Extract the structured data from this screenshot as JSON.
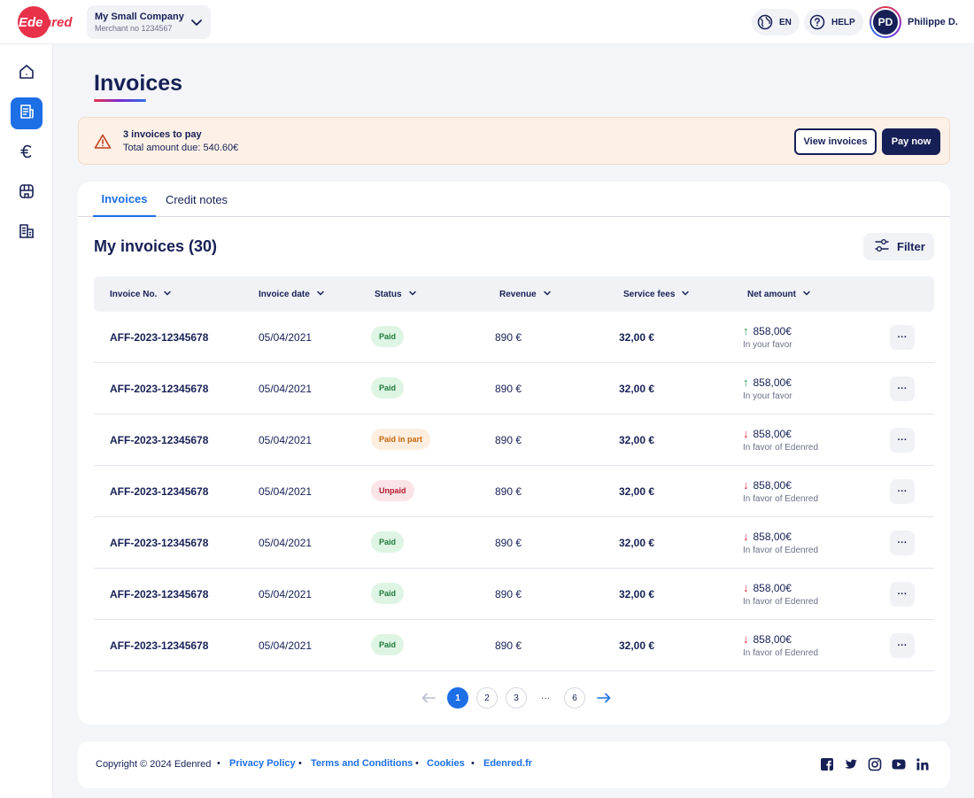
{
  "brand": {
    "logo_text": "Edenred",
    "accent": "#e9314a",
    "primary": "#162056",
    "blue": "#1d6fe6"
  },
  "merchant": {
    "name": "My Small Company",
    "number": "Merchant no 1234567"
  },
  "header": {
    "language": "EN",
    "help": "HELP",
    "user_initials": "PD",
    "user_name": "Philippe D."
  },
  "sidebar": {
    "items": [
      {
        "icon": "home-icon",
        "active": false
      },
      {
        "icon": "invoice-icon",
        "active": true
      },
      {
        "icon": "euro-icon",
        "active": false
      },
      {
        "icon": "store-icon",
        "active": false
      },
      {
        "icon": "building-icon",
        "active": false
      }
    ]
  },
  "page": {
    "title": "Invoices"
  },
  "alert": {
    "title": "3 invoices to pay",
    "subtitle": "Total amount due: 540.60€",
    "view_label": "View invoices",
    "pay_label": "Pay now"
  },
  "tabs": [
    {
      "label": "Invoices",
      "active": true
    },
    {
      "label": "Credit notes",
      "active": false
    }
  ],
  "section": {
    "title": "My invoices (30)",
    "filter_label": "Filter"
  },
  "table": {
    "columns": [
      "Invoice No.",
      "Invoice date",
      "Status",
      "Revenue",
      "Service fees",
      "Net amount"
    ],
    "rows": [
      {
        "invoice_no": "AFF-2023-12345678",
        "date": "05/04/2021",
        "status": "Paid",
        "status_type": "paid",
        "revenue": "890 €",
        "fees": "32,00 €",
        "net": "858,00€",
        "direction": "up",
        "net_note": "In your favor",
        "more": "···"
      },
      {
        "invoice_no": "AFF-2023-12345678",
        "date": "05/04/2021",
        "status": "Paid",
        "status_type": "paid",
        "revenue": "890 €",
        "fees": "32,00 €",
        "net": "858,00€",
        "direction": "up",
        "net_note": "In your favor",
        "more": "···"
      },
      {
        "invoice_no": "AFF-2023-12345678",
        "date": "05/04/2021",
        "status": "Paid in part",
        "status_type": "part",
        "revenue": "890 €",
        "fees": "32,00 €",
        "net": "858,00€",
        "direction": "down",
        "net_note": "In favor of Edenred",
        "more": "···"
      },
      {
        "invoice_no": "AFF-2023-12345678",
        "date": "05/04/2021",
        "status": "Unpaid",
        "status_type": "unpaid",
        "revenue": "890 €",
        "fees": "32,00 €",
        "net": "858,00€",
        "direction": "down",
        "net_note": "In favor of Edenred",
        "more": "···"
      },
      {
        "invoice_no": "AFF-2023-12345678",
        "date": "05/04/2021",
        "status": "Paid",
        "status_type": "paid",
        "revenue": "890 €",
        "fees": "32,00 €",
        "net": "858,00€",
        "direction": "down",
        "net_note": "In favor of Edenred",
        "more": "···"
      },
      {
        "invoice_no": "AFF-2023-12345678",
        "date": "05/04/2021",
        "status": "Paid",
        "status_type": "paid",
        "revenue": "890 €",
        "fees": "32,00 €",
        "net": "858,00€",
        "direction": "down",
        "net_note": "In favor of Edenred",
        "more": "···"
      },
      {
        "invoice_no": "AFF-2023-12345678",
        "date": "05/04/2021",
        "status": "Paid",
        "status_type": "paid",
        "revenue": "890 €",
        "fees": "32,00 €",
        "net": "858,00€",
        "direction": "down",
        "net_note": "In favor of Edenred",
        "more": "···"
      }
    ]
  },
  "pagination": {
    "pages": [
      "1",
      "2",
      "3",
      "···",
      "6"
    ],
    "current": "1"
  },
  "footer": {
    "copyright": "Copyright © 2024 Edenred",
    "links": [
      "Privacy Policy",
      "Terms and Conditions",
      "Cookies",
      "Edenred.fr"
    ],
    "social": [
      "facebook-icon",
      "twitter-icon",
      "instagram-icon",
      "youtube-icon",
      "linkedin-icon"
    ]
  }
}
